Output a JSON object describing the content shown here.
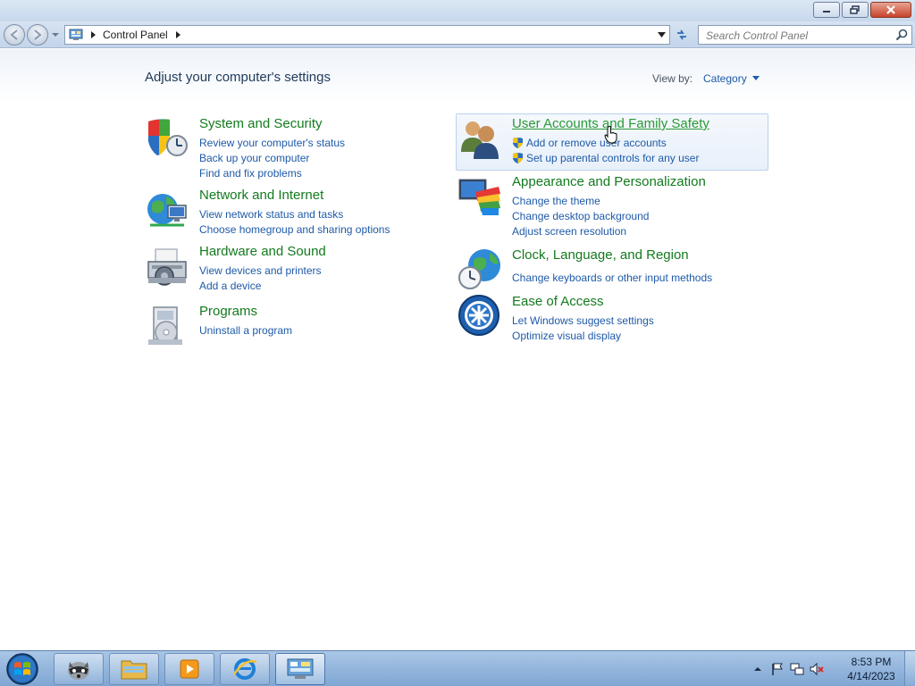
{
  "nav": {
    "breadcrumb": "Control Panel",
    "search_placeholder": "Search Control Panel"
  },
  "header": {
    "title": "Adjust your computer's settings",
    "view_by_label": "View by:",
    "view_by_value": "Category"
  },
  "categories_left": [
    {
      "title": "System and Security",
      "links": [
        "Review your computer's status",
        "Back up your computer",
        "Find and fix problems"
      ],
      "icon": "shield-icon"
    },
    {
      "title": "Network and Internet",
      "links": [
        "View network status and tasks",
        "Choose homegroup and sharing options"
      ],
      "icon": "network-globe-icon"
    },
    {
      "title": "Hardware and Sound",
      "links": [
        "View devices and printers",
        "Add a device"
      ],
      "icon": "printer-icon"
    },
    {
      "title": "Programs",
      "links": [
        "Uninstall a program"
      ],
      "icon": "programs-icon"
    }
  ],
  "categories_right": [
    {
      "title": "User Accounts and Family Safety",
      "links": [
        "Add or remove user accounts",
        "Set up parental controls for any user"
      ],
      "icon": "users-icon"
    },
    {
      "title": "Appearance and Personalization",
      "links": [
        "Change the theme",
        "Change desktop background",
        "Adjust screen resolution"
      ],
      "icon": "monitor-palette-icon"
    },
    {
      "title": "Clock, Language, and Region",
      "links": [
        "Change keyboards or other input methods"
      ],
      "icon": "globe-clock-icon"
    },
    {
      "title": "Ease of Access",
      "links": [
        "Let Windows suggest settings",
        "Optimize visual display"
      ],
      "icon": "ease-of-access-icon"
    }
  ],
  "taskbar": {
    "time": "8:53 PM",
    "date": "4/14/2023"
  },
  "colors": {
    "category_title": "#137a1e",
    "link": "#1e5aa8",
    "taskbar": "#8fb2dc"
  }
}
